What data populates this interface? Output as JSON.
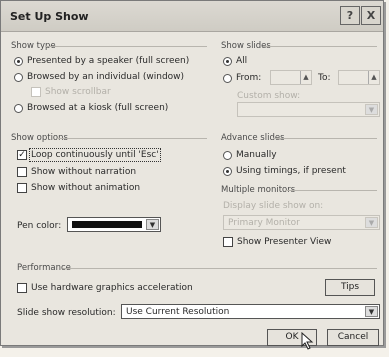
{
  "dialog": {
    "title": "Set Up Show",
    "help_button": "?",
    "close_button": "X"
  },
  "show_type": {
    "label": "Show type",
    "presented_by_speaker": "Presented by a speaker (full screen)",
    "browsed_by_individual": "Browsed by an individual (window)",
    "show_scrollbar": "Show scrollbar",
    "browsed_at_kiosk": "Browsed at a kiosk (full screen)"
  },
  "show_slides": {
    "label": "Show slides",
    "all": "All",
    "from": "From:",
    "to": "To:",
    "custom_show": "Custom show:"
  },
  "show_options": {
    "label": "Show options",
    "loop_continuously": "Loop continuously until 'Esc'",
    "without_narration": "Show without narration",
    "without_animation": "Show without animation",
    "pen_color": "Pen color:"
  },
  "advance_slides": {
    "label": "Advance slides",
    "manually": "Manually",
    "using_timings": "Using timings, if present"
  },
  "multiple_monitors": {
    "label": "Multiple monitors",
    "display_on": "Display slide show on:",
    "primary_monitor": "Primary Monitor",
    "show_presenter_view": "Show Presenter View"
  },
  "performance": {
    "label": "Performance",
    "hardware_acceleration": "Use hardware graphics acceleration",
    "tips_button": "Tips",
    "resolution_label": "Slide show resolution:",
    "resolution_value": "Use Current Resolution"
  },
  "buttons": {
    "ok": "OK",
    "cancel": "Cancel"
  },
  "colors": {
    "pen_color": "#111111",
    "dialog_bg": "#e9e6df"
  }
}
